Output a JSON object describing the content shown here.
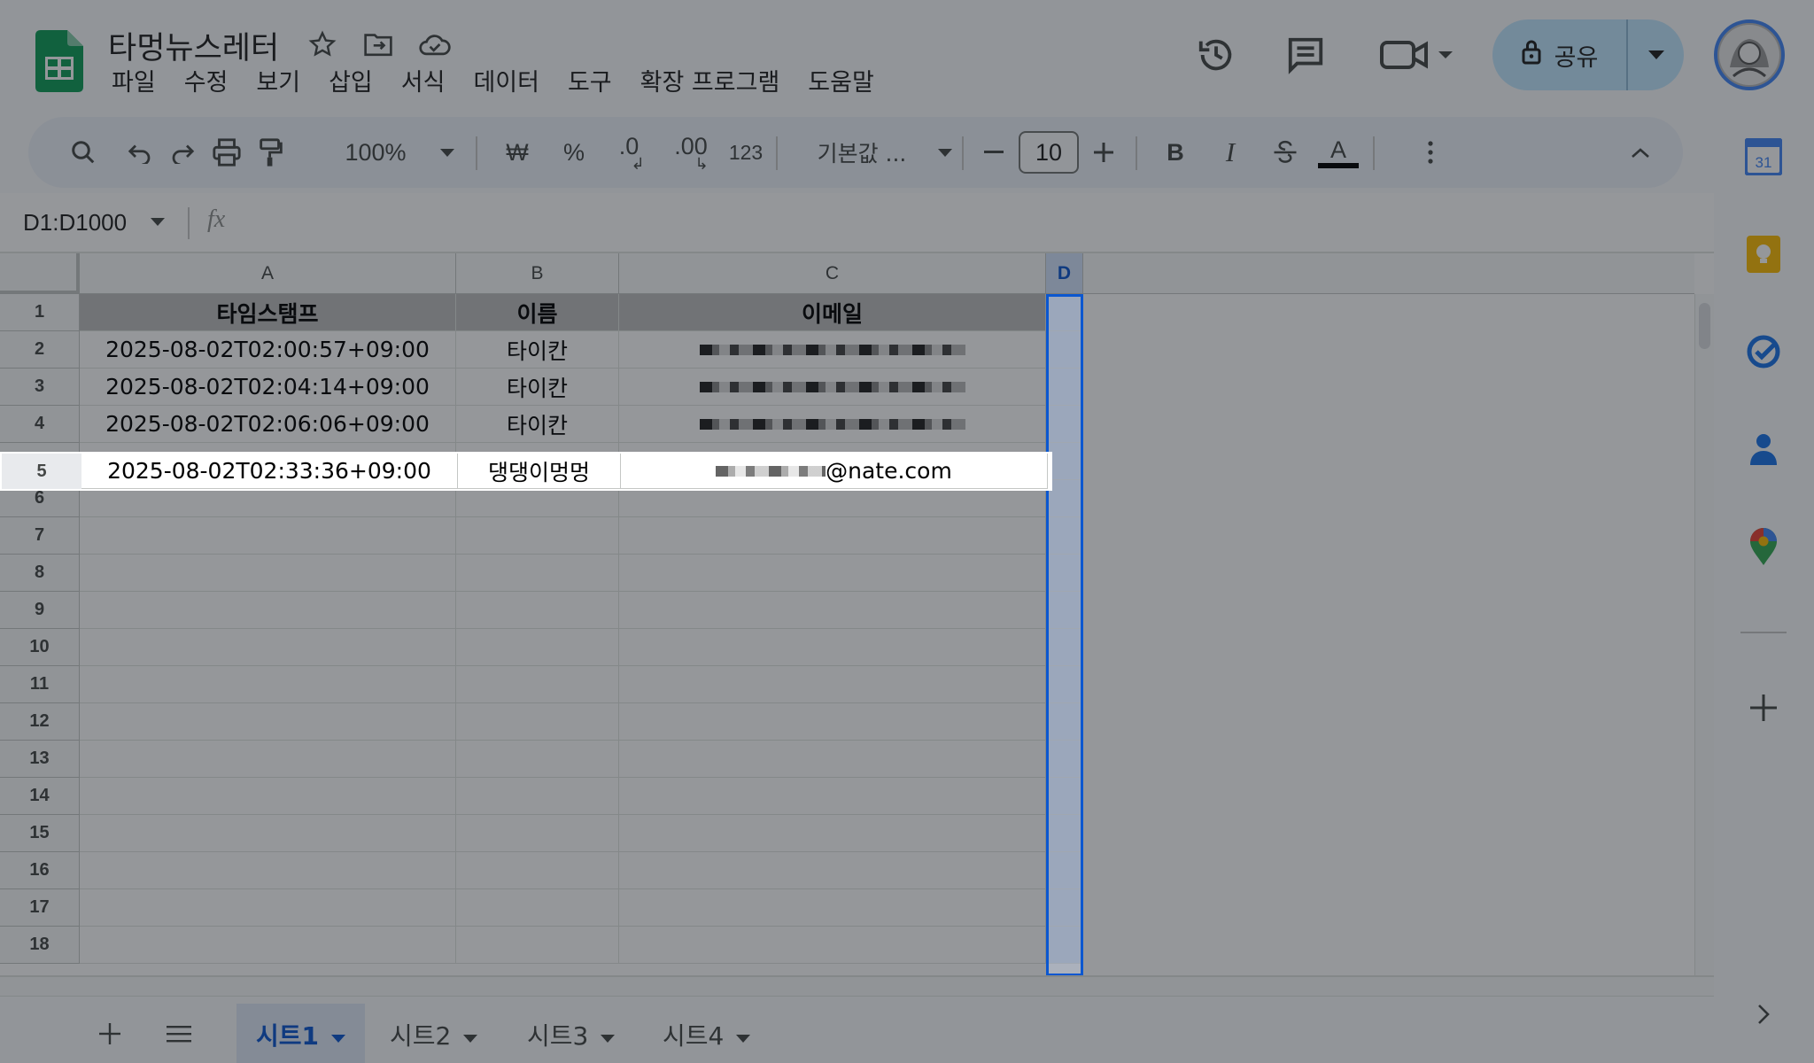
{
  "app": {
    "doc_title": "타멍뉴스레터",
    "menu": [
      "파일",
      "수정",
      "보기",
      "삽입",
      "서식",
      "데이터",
      "도구",
      "확장 프로그램",
      "도움말"
    ],
    "share_label": "공유"
  },
  "toolbar": {
    "zoom": "100%",
    "currency": "₩",
    "percent": "%",
    "decrease_decimal": ".0",
    "increase_decimal": ".00",
    "number_format": "123",
    "font": "기본값 ...",
    "font_size": "10",
    "bold": "B",
    "italic": "I",
    "text_color": "A"
  },
  "formula_bar": {
    "name_box": "D1:D1000",
    "fx": "fx"
  },
  "grid": {
    "columns": [
      "A",
      "B",
      "C",
      "D"
    ],
    "row_numbers": [
      "1",
      "2",
      "3",
      "4",
      "5",
      "6",
      "7",
      "8",
      "9",
      "10",
      "11",
      "12",
      "13",
      "14",
      "15",
      "16",
      "17",
      "18"
    ],
    "header_row": [
      "타임스탬프",
      "이름",
      "이메일"
    ],
    "rows": [
      {
        "timestamp": "2025-08-02T02:00:57+09:00",
        "name": "타이칸",
        "email": ""
      },
      {
        "timestamp": "2025-08-02T02:04:14+09:00",
        "name": "타이칸",
        "email": ""
      },
      {
        "timestamp": "2025-08-02T02:06:06+09:00",
        "name": "타이칸",
        "email": ""
      },
      {
        "timestamp": "2025-08-02T02:33:36+09:00",
        "name": "댕댕이멍멍",
        "email": "@nate.com"
      }
    ],
    "selected_range": "D1:D1000",
    "highlighted_row": "5"
  },
  "sheets": {
    "tabs": [
      "시트1",
      "시트2",
      "시트3",
      "시트4"
    ],
    "active": "시트1"
  },
  "side_panel": {
    "calendar_day": "31",
    "icons": [
      "calendar-icon",
      "keep-icon",
      "tasks-icon",
      "contacts-icon",
      "maps-icon",
      "add-icon"
    ]
  },
  "colors": {
    "share_bg": "#c2e7ff",
    "selection": "#0b57d0",
    "header_fill": "#bdbdbd",
    "dim_overlay": "rgba(20,24,32,0.45)"
  }
}
